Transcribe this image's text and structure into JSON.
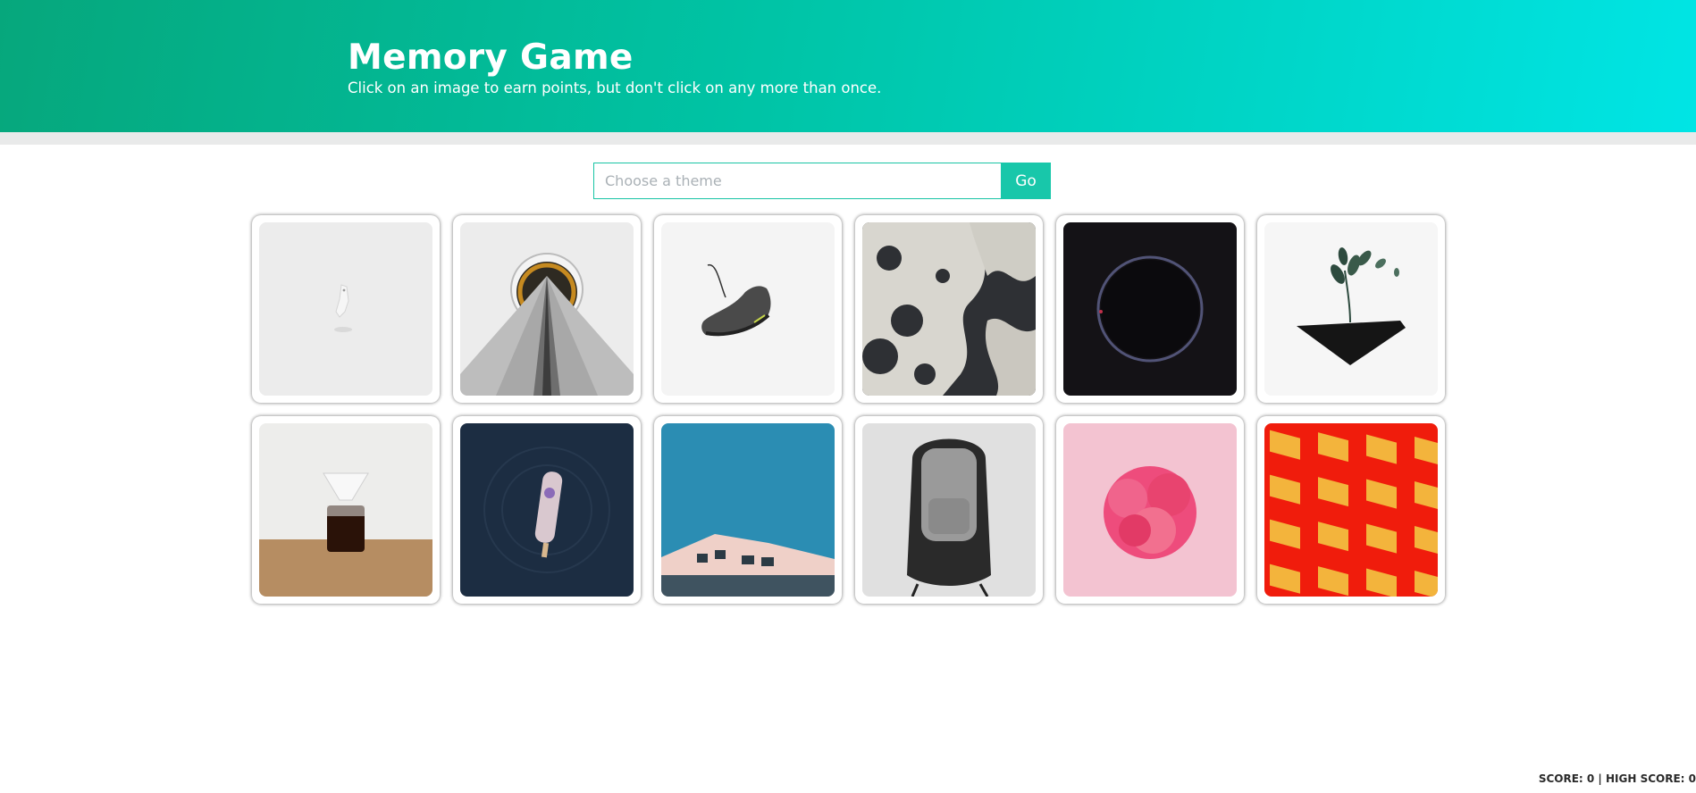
{
  "header": {
    "title": "Memory Game",
    "subtitle": "Click on an image to earn points, but don't click on any more than once."
  },
  "search": {
    "placeholder": "Choose a theme",
    "go_label": "Go"
  },
  "cards": [
    {
      "name": "card-white-figure"
    },
    {
      "name": "card-tower"
    },
    {
      "name": "card-sneaker"
    },
    {
      "name": "card-leaf-shadows"
    },
    {
      "name": "card-eclipse"
    },
    {
      "name": "card-floating-plant"
    },
    {
      "name": "card-coffee-pour-over"
    },
    {
      "name": "card-popsicle-water"
    },
    {
      "name": "card-building-sky"
    },
    {
      "name": "card-backpack-chair"
    },
    {
      "name": "card-pink-carnation"
    },
    {
      "name": "card-yellow-boxes"
    }
  ],
  "scoreboard": {
    "text": "SCORE: 0 | HIGH SCORE: 0"
  },
  "colors": {
    "header_start": "#06a77c",
    "header_end": "#00e5e5",
    "accent": "#18c7aa"
  }
}
